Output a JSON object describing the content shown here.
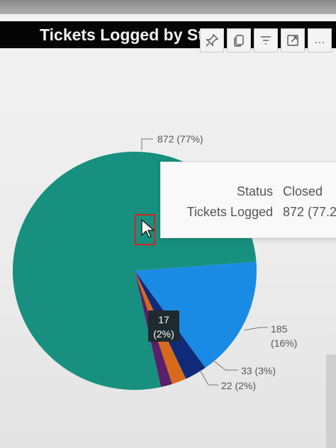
{
  "visual": {
    "title": "Tickets Logged by Sta"
  },
  "toolbar": {
    "icons": [
      "pin-icon",
      "copy-icon",
      "filter-icon",
      "focus-mode-icon",
      "more-options-icon"
    ],
    "more_glyph": "…"
  },
  "chart_data": {
    "type": "pie",
    "series": [
      {
        "category": "Closed",
        "value": 872,
        "percent": "77%",
        "label": "872 (77%)",
        "color": "#17907f"
      },
      {
        "category": "",
        "value": 185,
        "percent": "16%",
        "label_value": "185",
        "label_percent": "(16%)",
        "color": "#1a8be4"
      },
      {
        "category": "",
        "value": 33,
        "percent": "3%",
        "label": "33 (3%)",
        "color": "#0f2a78"
      },
      {
        "category": "",
        "value": 22,
        "percent": "2%",
        "label": "22 (2%)",
        "color": "#d66a1a"
      },
      {
        "category": "",
        "value": 17,
        "percent": "2%",
        "label_value": "17",
        "label_percent": "(2%)",
        "color": "#5a1f6b"
      }
    ]
  },
  "tooltip": {
    "status_key": "Status",
    "status_value": "Closed",
    "count_key": "Tickets Logged",
    "count_value": "872 (77.2"
  }
}
